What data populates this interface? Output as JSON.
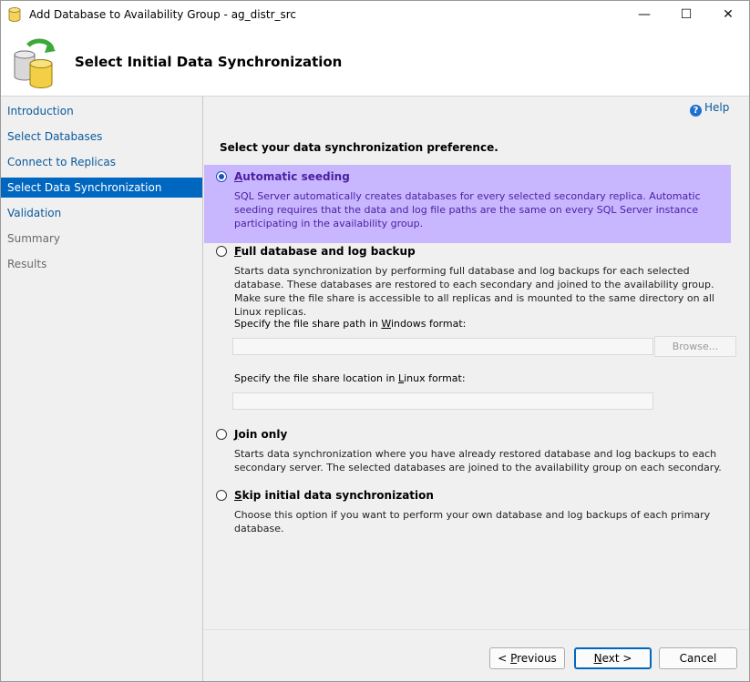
{
  "window": {
    "title": "Add Database to Availability Group - ag_distr_src",
    "minimize_glyph": "—",
    "maximize_glyph": "☐",
    "close_glyph": "✕"
  },
  "header": {
    "title": "Select Initial Data Synchronization"
  },
  "sidebar": {
    "items": [
      {
        "label": "Introduction",
        "state": "link"
      },
      {
        "label": "Select Databases",
        "state": "link"
      },
      {
        "label": "Connect to Replicas",
        "state": "link"
      },
      {
        "label": "Select Data Synchronization",
        "state": "active"
      },
      {
        "label": "Validation",
        "state": "link"
      },
      {
        "label": "Summary",
        "state": "disabled"
      },
      {
        "label": "Results",
        "state": "disabled"
      }
    ]
  },
  "help": {
    "label": "Help",
    "icon": "question-circle-icon"
  },
  "main": {
    "prompt": "Select your data synchronization preference.",
    "options": {
      "automatic": {
        "label_first": "A",
        "label_rest": "utomatic seeding",
        "selected": true,
        "description": "SQL Server automatically creates databases for every selected secondary replica. Automatic seeding requires that the data and log file paths are the same on every SQL Server instance participating in the availability group."
      },
      "full": {
        "label_first": "F",
        "label_rest": "ull database and log backup",
        "selected": false,
        "description": "Starts data synchronization by performing full database and log backups for each selected database. These databases are restored to each secondary and joined to the availability group. Make sure the file share is accessible to all replicas and is mounted to the same directory on all Linux replicas.",
        "windows_path_label_pre": "Specify the file share path in ",
        "windows_path_label_key": "W",
        "windows_path_label_post": "indows format:",
        "windows_path_value": "",
        "browse_label": "Browse...",
        "linux_path_label_pre": "Specify the file share location in ",
        "linux_path_label_key": "L",
        "linux_path_label_post": "inux format:",
        "linux_path_value": ""
      },
      "join": {
        "label_first": "J",
        "label_rest": "oin only",
        "selected": false,
        "description": "Starts data synchronization where you have already restored database and log backups to each secondary server. The selected databases are joined to the availability group on each secondary."
      },
      "skip": {
        "label_first": "S",
        "label_rest": "kip initial data synchronization",
        "selected": false,
        "description": "Choose this option if you want to perform your own database and log backups of each primary database."
      }
    }
  },
  "footer": {
    "previous_pre": "< ",
    "previous_key": "P",
    "previous_post": "revious",
    "next_key": "N",
    "next_post": "ext >",
    "cancel_label": "Cancel"
  },
  "colors": {
    "accent": "#0067c0",
    "selected_option_bg": "#c8b6ff",
    "selected_option_text": "#4b1fa0",
    "link": "#0a5a9c"
  }
}
